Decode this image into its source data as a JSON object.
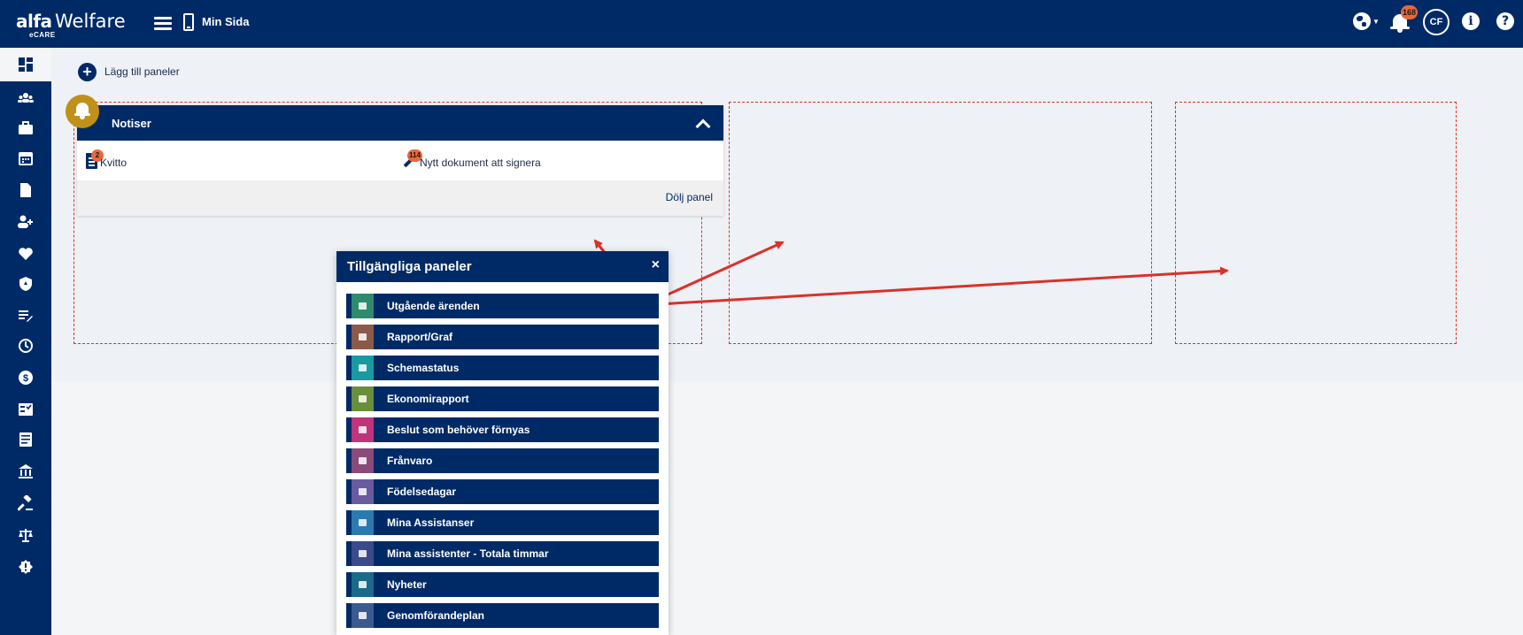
{
  "app": {
    "logo_word": "alfa",
    "logo_name": "Welfare",
    "logo_sub": "eCARE",
    "page_title": "Min Sida"
  },
  "header": {
    "notification_count": "168",
    "user_initials": "CF",
    "info_symbol": "i",
    "help_symbol": "?"
  },
  "sidebar": {
    "items": [
      {
        "icon": "dashboard-icon",
        "active": true
      },
      {
        "icon": "group-icon"
      },
      {
        "icon": "briefcase-icon"
      },
      {
        "icon": "calendar-icon"
      },
      {
        "icon": "document-icon"
      },
      {
        "icon": "add-person-icon"
      },
      {
        "icon": "heart-icon"
      },
      {
        "icon": "shield-icon"
      },
      {
        "icon": "list-edit-icon"
      },
      {
        "icon": "clock-icon"
      },
      {
        "icon": "dollar-icon"
      },
      {
        "icon": "checklist-icon"
      },
      {
        "icon": "article-icon"
      },
      {
        "icon": "bank-icon"
      },
      {
        "icon": "gavel-icon"
      },
      {
        "icon": "scales-icon"
      },
      {
        "icon": "alert-badge-icon"
      }
    ]
  },
  "toolbar": {
    "add_panels_label": "Lägg till paneler"
  },
  "notiser_panel": {
    "title": "Notiser",
    "items": [
      {
        "label": "Kvitto",
        "count": "2",
        "icon": "receipt-icon"
      },
      {
        "label": "Nytt dokument att signera",
        "count": "114",
        "icon": "pen-icon"
      }
    ],
    "hide_label": "Dölj panel"
  },
  "dialog": {
    "title": "Tillgängliga paneler",
    "close_symbol": "×",
    "panels": [
      {
        "label": "Utgående ärenden",
        "color": "#2e8b6e"
      },
      {
        "label": "Rapport/Graf",
        "color": "#8c5a48"
      },
      {
        "label": "Schemastatus",
        "color": "#1a9aa0"
      },
      {
        "label": "Ekonomirapport",
        "color": "#6a8f3a"
      },
      {
        "label": "Beslut som behöver förnyas",
        "color": "#c0347a"
      },
      {
        "label": "Frånvaro",
        "color": "#8a4a7a"
      },
      {
        "label": "Födelsedagar",
        "color": "#6a5aa0"
      },
      {
        "label": "Mina Assistanser",
        "color": "#2a7ab0"
      },
      {
        "label": "Mina assistenter - Totala timmar",
        "color": "#3a4a8a"
      },
      {
        "label": "Nyheter",
        "color": "#1a6a8a"
      },
      {
        "label": "Genomförandeplan",
        "color": "#3a5a90"
      }
    ]
  },
  "colors": {
    "brand": "#002a66",
    "badge": "#e8683a",
    "dropzone_border": "#d9322a",
    "arrow": "#d9322a",
    "notiser_icon_bg": "#c0901a"
  }
}
